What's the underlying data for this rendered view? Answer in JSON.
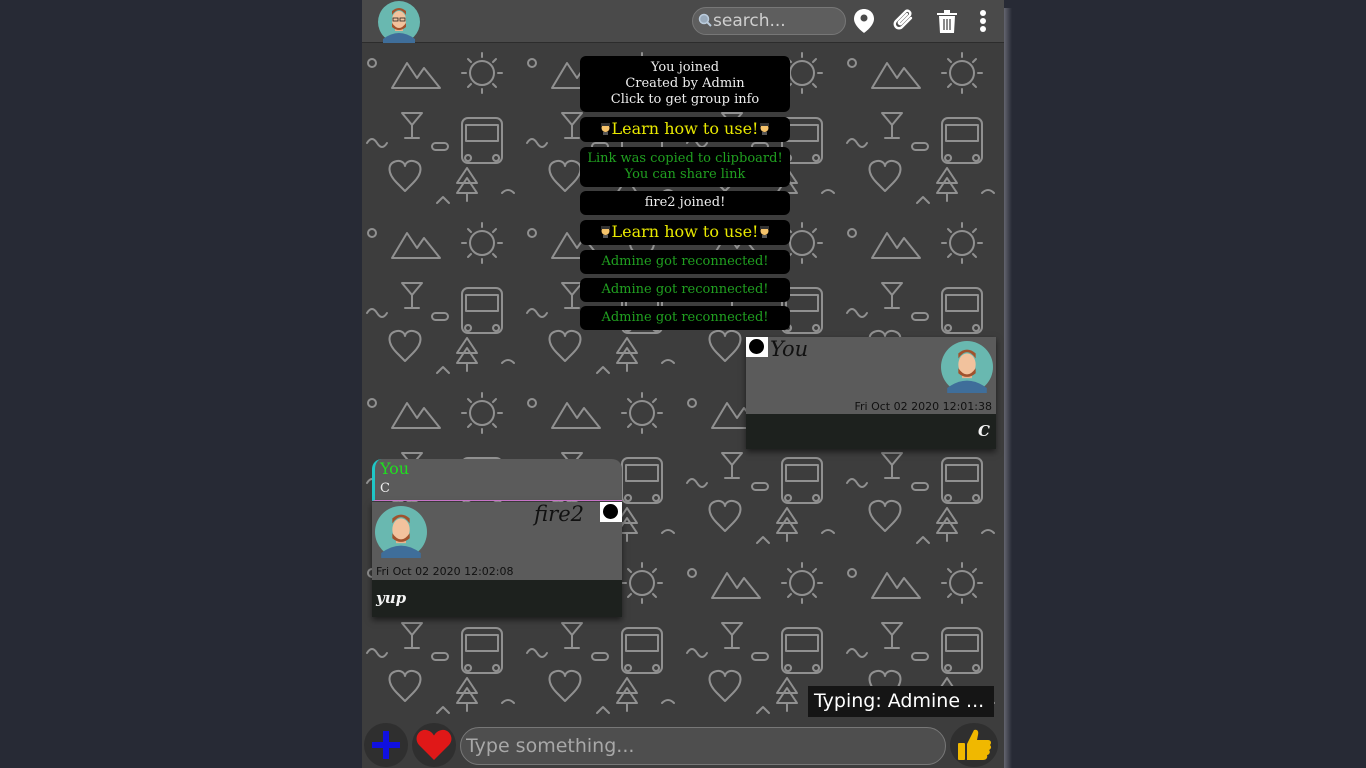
{
  "header": {
    "search_placeholder": "search...",
    "icons": [
      "location-pin-icon",
      "paperclip-icon",
      "trash-icon",
      "more-vertical-icon"
    ]
  },
  "system_messages": {
    "join_lines": [
      "You joined",
      "Created by Admin",
      "Click to get group info"
    ],
    "learn": "Learn how to use!",
    "link_lines": [
      "Link was copied to clipboard!",
      "You can share link"
    ],
    "fire2_joined": "fire2 joined!",
    "reconnected": "Admine got reconnected!"
  },
  "messages": [
    {
      "sender": "You",
      "time": "Fri Oct 02 2020 12:01:38",
      "text": "C"
    },
    {
      "reply_to_sender": "You",
      "reply_to_text": "C",
      "sender": "fire2",
      "time": "Fri Oct 02 2020 12:02:08",
      "text": "yup"
    }
  ],
  "typing": "Typing: Admine ...",
  "footer": {
    "input_placeholder": "Type something...",
    "icons": [
      "plus-icon",
      "heart-icon",
      "thumbs-up-icon"
    ]
  },
  "colors": {
    "page_bg": "#272a35",
    "chat_bg": "#3d3d3d",
    "learn_text": "#e8e800",
    "green_text": "#20a020",
    "reply_name": "#1fe01f"
  }
}
